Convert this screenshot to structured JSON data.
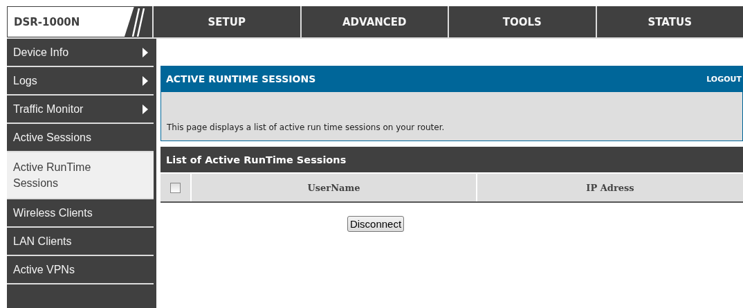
{
  "logo": "DSR-1000N",
  "tabs": [
    {
      "label": "SETUP",
      "selected": false
    },
    {
      "label": "ADVANCED",
      "selected": false
    },
    {
      "label": "TOOLS",
      "selected": false
    },
    {
      "label": "STATUS",
      "selected": false
    }
  ],
  "sidebar": {
    "items": [
      {
        "label": "Device Info",
        "has_submenu": true,
        "selected": false
      },
      {
        "label": "Logs",
        "has_submenu": true,
        "selected": false
      },
      {
        "label": "Traffic Monitor",
        "has_submenu": true,
        "selected": false
      },
      {
        "label": "Active Sessions",
        "has_submenu": false,
        "selected": false
      },
      {
        "label": "Active RunTime Sessions",
        "has_submenu": false,
        "selected": true
      },
      {
        "label": "Wireless Clients",
        "has_submenu": false,
        "selected": false
      },
      {
        "label": "LAN Clients",
        "has_submenu": false,
        "selected": false
      },
      {
        "label": "Active VPNs",
        "has_submenu": false,
        "selected": false
      }
    ]
  },
  "banner": {
    "title": "ACTIVE RUNTIME SESSIONS",
    "logout": "LOGOUT"
  },
  "description": "This page displays a list of active run time sessions on your router.",
  "table": {
    "title": "List of Active RunTime Sessions",
    "select_all_checked": false,
    "columns": [
      "UserName",
      "IP Adress"
    ]
  },
  "buttons": [
    "Disconnect"
  ]
}
